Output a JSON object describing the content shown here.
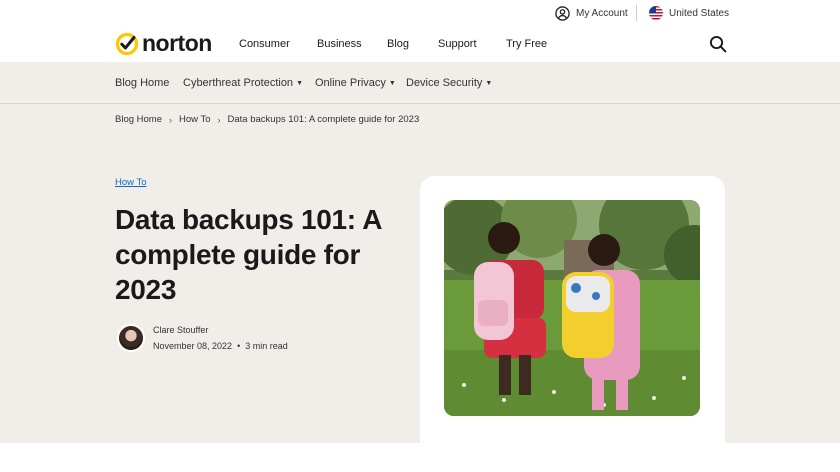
{
  "utility": {
    "account_label": "My Account",
    "country_label": "United States"
  },
  "logo": {
    "text": "norton"
  },
  "nav": {
    "items": [
      "Consumer",
      "Business",
      "Blog",
      "Support",
      "Try Free"
    ]
  },
  "subnav": {
    "items": [
      {
        "label": "Blog Home",
        "has_dropdown": false
      },
      {
        "label": "Cyberthreat Protection",
        "has_dropdown": true
      },
      {
        "label": "Online Privacy",
        "has_dropdown": true
      },
      {
        "label": "Device Security",
        "has_dropdown": true
      }
    ]
  },
  "breadcrumb": {
    "items": [
      "Blog Home",
      "How To",
      "Data backups 101: A complete guide for 2023"
    ]
  },
  "article": {
    "category": "How To",
    "title": "Data backups 101: A complete guide for 2023",
    "author": "Clare Stouffer",
    "date": "November 08, 2022",
    "read_time": "3 min read"
  },
  "colors": {
    "brand_yellow": "#ffc700",
    "hero_bg": "#f1eeea",
    "link_blue": "#0a6ec9",
    "text": "#1a1a1a"
  },
  "icons": {
    "logo_mark": "checkmark-circle-icon",
    "account": "user-circle-icon",
    "country": "us-flag-icon",
    "search": "search-icon",
    "dropdown": "chevron-down-icon",
    "crumb_separator": "chevron-right-icon"
  }
}
